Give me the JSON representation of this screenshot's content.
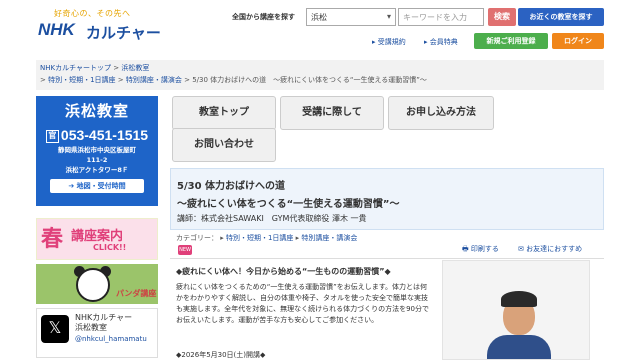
{
  "header": {
    "logo_tagline": "好奇心の、その先へ",
    "logo_nhk": "NHK",
    "logo_culture": "カルチャー",
    "search_label": "全国から講座を探す",
    "area_select_value": "浜松",
    "keyword_placeholder": "キーワードを入力",
    "search_button": "検索",
    "nearby_button": "お近くの教室を探す",
    "terms_link": "受講規約",
    "member_link": "会員特典",
    "first_use_button": "新規ご利用登録",
    "login_button": "ログイン"
  },
  "breadcrumb": {
    "items": [
      "NHKカルチャートップ",
      "浜松教室",
      "特別・短期・1日講座",
      "特別講座・講演会"
    ],
    "current": "5/30 体力おばけへの道　～疲れにくい体をつくる“一生使える運動習慣”～"
  },
  "sidebar": {
    "classroom_title": "浜松教室",
    "tel_icon": "官",
    "phone": "053-451-1515",
    "address_line1": "静岡県浜松市中央区板屋町",
    "address_line2": "111-2",
    "address_line3": "浜松アクトタワー8Ｆ",
    "map_button": "地図・受付時間",
    "banner_spring_big": "春",
    "banner_spring_text": "講座案内",
    "banner_spring_click": "CLICK!!",
    "banner_panda_label": "パンダ講座",
    "x_name_line1": "NHKカルチャー",
    "x_name_line2": "浜松教室",
    "x_handle": "@nhkcul_hamamatu"
  },
  "tabs": [
    "教室トップ",
    "受講に際して",
    "お申し込み方法",
    "お問い合わせ"
  ],
  "event": {
    "title_line1": "5/30 体力おばけへの道",
    "title_line2": "～疲れにくい体をつくる“一生使える運動習慣”～",
    "instructor": "講師：株式会社SAWAKI　GYM代表取締役 澤木 一貴",
    "category_label": "カテゴリー：",
    "category_items": [
      "特別・短期・1日講座",
      "特別講座・講演会"
    ],
    "new_badge": "NEW",
    "print_link": "印刷する",
    "mail_link": "お友達におすすめ",
    "lead": "◆疲れにくい体へ！今日から始める“一生ものの運動習慣”◆",
    "body": "疲れにくい体をつくるための“一生使える運動習慣”をお伝えします。体力とは何かをわかりやすく解説し、自分の体重や椅子、タオルを使った安全で簡単な実技も実施します。全年代を対象に、無理なく続けられる体力づくりの方法を90分でお伝えいたします。運動が苦手な方も安心してご参加ください。",
    "body2": "◆2026年5月30日(土)開講◆"
  }
}
